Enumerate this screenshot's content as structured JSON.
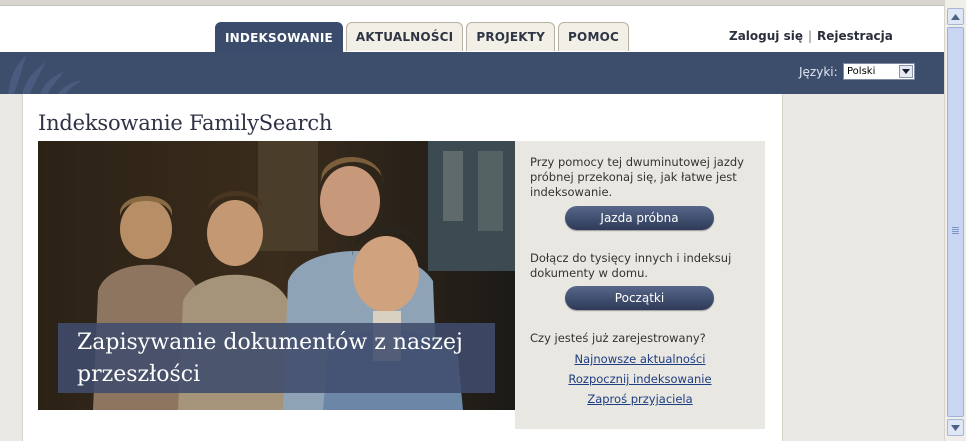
{
  "nav": {
    "tabs": [
      {
        "label": "INDEKSOWANIE",
        "active": true
      },
      {
        "label": "AKTUALNOŚCI",
        "active": false
      },
      {
        "label": "PROJEKTY",
        "active": false
      },
      {
        "label": "POMOC",
        "active": false
      }
    ],
    "login_label": "Zaloguj się",
    "separator": "|",
    "register_label": "Rejestracja"
  },
  "banner": {
    "language_label": "Języki:",
    "language_selected": "Polski"
  },
  "main": {
    "title": "Indeksowanie FamilySearch",
    "hero_caption": "Zapisywanie dokumentów z naszej przeszłości",
    "test_drive_text": "Przy pomocy tej dwuminutowej jazdy próbnej przekonaj się, jak łatwe jest indeksowanie.",
    "test_drive_button": "Jazda próbna",
    "join_text": "Dołącz do tysięcy innych i indeksuj dokumenty w domu.",
    "get_started_button": "Początki",
    "registered_question": "Czy jesteś już zarejestrowany?",
    "links": [
      "Najnowsze aktualności",
      "Rozpocznij indeksowanie",
      "Zaproś przyjaciela"
    ]
  },
  "colors": {
    "banner": "#3d4e6d",
    "active_tab": "#3a4b6b",
    "link": "#1f3d82",
    "background": "#ebe9e3"
  }
}
